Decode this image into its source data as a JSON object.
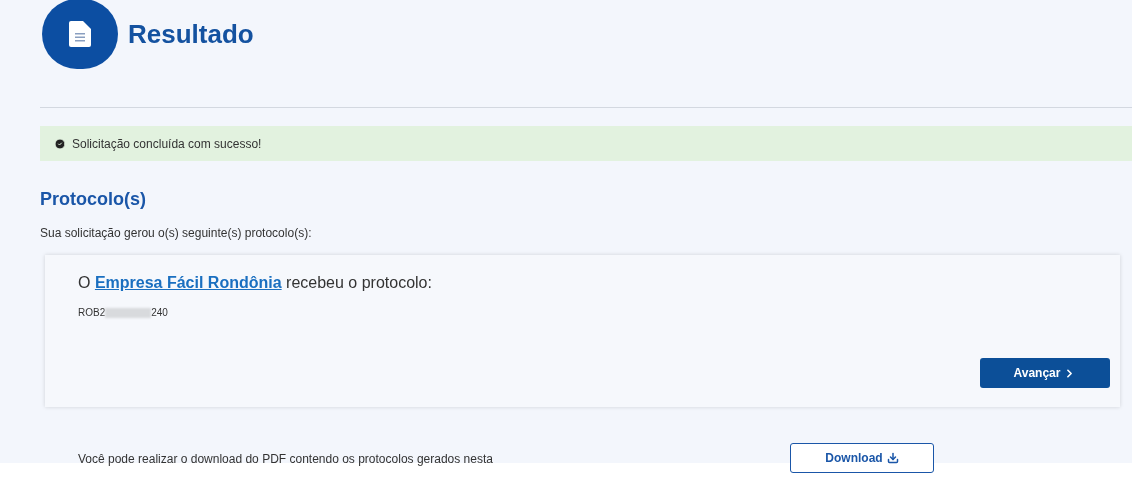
{
  "header": {
    "title": "Resultado"
  },
  "alert": {
    "kind": "success",
    "message": "Solicitação concluída com sucesso!"
  },
  "section": {
    "title": "Protocolo(s)",
    "subtitle": "Sua solicitação gerou o(s) seguinte(s) protocolo(s):"
  },
  "protocol_card": {
    "prefix": "O",
    "link": "Empresa Fácil Rondônia",
    "suffix": "recebeu o protocolo:",
    "number_start": "ROB2",
    "number_redacted": true,
    "number_end": "240",
    "button": "Avançar"
  },
  "download": {
    "text": "Você pode realizar o download do PDF contendo os protocolos gerados nesta",
    "button": "Download"
  }
}
